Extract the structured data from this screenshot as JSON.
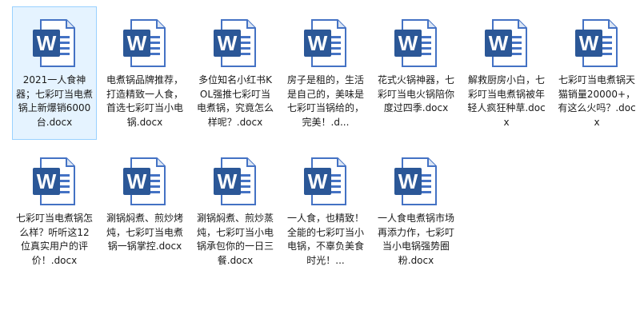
{
  "files": [
    {
      "name": "2021一人食神器；七彩叮当电煮锅上新爆销6000台.docx",
      "selected": true
    },
    {
      "name": "电煮锅品牌推荐，打造精致一人食，首选七彩叮当小电锅.docx"
    },
    {
      "name": "多位知名小红书KOL强推七彩叮当电煮锅，究竟怎么样呢？.docx"
    },
    {
      "name": "房子是租的，生活是自己的，美味是七彩叮当锅给的，完美！.d..."
    },
    {
      "name": "花式火锅神器，七彩叮当电火锅陪你度过四季.docx"
    },
    {
      "name": "解救厨房小白，七彩叮当电煮锅被年轻人疯狂种草.docx"
    },
    {
      "name": "七彩叮当电煮锅天猫销量20000+，有这么火吗？.docx"
    },
    {
      "name": "七彩叮当电煮锅怎么样？听听这12位真实用户的评价！.docx"
    },
    {
      "name": "涮锅焖煮、煎炒烤炖，七彩叮当电煮锅一锅掌控.docx"
    },
    {
      "name": "涮锅焖煮、煎炒蒸炖，七彩叮当小电锅承包你的一日三餐.docx"
    },
    {
      "name": "一人食，也精致！全能的七彩叮当小电锅，不辜负美食时光！..."
    },
    {
      "name": "一人食电煮锅市场再添力作，七彩叮当小电锅强势圈粉.docx"
    }
  ],
  "icon": {
    "name": "word-document-icon",
    "letter": "W",
    "accent": "#2b5797",
    "page_border": "#4472c4",
    "page_bg": "#ffffff"
  }
}
